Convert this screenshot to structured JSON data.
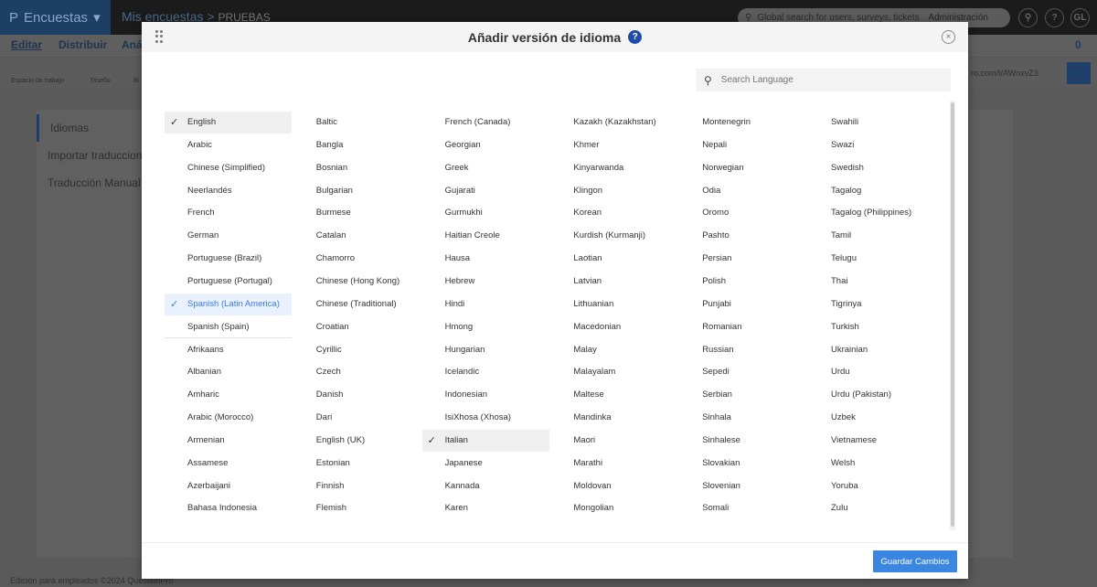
{
  "app": {
    "brand": "Encuestas",
    "breadcrumb_parent": "Mis encuestas",
    "breadcrumb_current": "PRUEBAS",
    "global_search_placeholder": "Global search for users, surveys, tickets",
    "admin_label": "Administración",
    "user_initials": "GL",
    "help": "?",
    "collab_count": "0"
  },
  "nav": {
    "tabs": [
      "Editar",
      "Distribuir",
      "Anál"
    ],
    "tools": [
      "Espacio de trabajo",
      "Diseño",
      "Bi"
    ],
    "url_fragment": "ro.com/t/AWnxvZ3"
  },
  "sidebar": {
    "items": [
      "Idiomas",
      "Importar traducciones",
      "Traducción Manual"
    ]
  },
  "footer": {
    "text": "Edición para empleados ©2024 QuestionPro"
  },
  "modal": {
    "title": "Añadir versión de idioma",
    "help": "?",
    "close": "×",
    "search_placeholder": "Search Language",
    "save_label": "Guardar Cambios",
    "columns": [
      [
        "English",
        "Arabic",
        "Chinese (Simplified)",
        "Neerlandés",
        "French",
        "German",
        "Portuguese (Brazil)",
        "Portuguese (Portugal)",
        "Spanish (Latin America)",
        "Spanish (Spain)",
        "Afrikaans",
        "Albanian",
        "Amharic",
        "Arabic (Morocco)",
        "Armenian",
        "Assamese",
        "Azerbaijani",
        "Bahasa Indonesia"
      ],
      [
        "Baltic",
        "Bangla",
        "Bosnian",
        "Bulgarian",
        "Burmese",
        "Catalan",
        "Chamorro",
        "Chinese (Hong Kong)",
        "Chinese (Traditional)",
        "Croatian",
        "Cyrillic",
        "Czech",
        "Danish",
        "Dari",
        "English (UK)",
        "Estonian",
        "Finnish",
        "Flemish"
      ],
      [
        "French (Canada)",
        "Georgian",
        "Greek",
        "Gujarati",
        "Gurmukhi",
        "Haitian Creole",
        "Hausa",
        "Hebrew",
        "Hindi",
        "Hmong",
        "Hungarian",
        "Icelandic",
        "Indonesian",
        "IsiXhosa (Xhosa)",
        "Italian",
        "Japanese",
        "Kannada",
        "Karen"
      ],
      [
        "Kazakh (Kazakhstan)",
        "Khmer",
        "Kinyarwanda",
        "Klingon",
        "Korean",
        "Kurdish (Kurmanji)",
        "Laotian",
        "Latvian",
        "Lithuanian",
        "Macedonian",
        "Malay",
        "Malayalam",
        "Maltese",
        "Mandinka",
        "Maori",
        "Marathi",
        "Moldovan",
        "Mongolian"
      ],
      [
        "Montenegrin",
        "Nepali",
        "Norwegian",
        "Odia",
        "Oromo",
        "Pashto",
        "Persian",
        "Polish",
        "Punjabi",
        "Romanian",
        "Russian",
        "Sepedi",
        "Serbian",
        "Sinhala",
        "Sinhalese",
        "Slovakian",
        "Slovenian",
        "Somali"
      ],
      [
        "Swahili",
        "Swazi",
        "Swedish",
        "Tagalog",
        "Tagalog (Philippines)",
        "Tamil",
        "Telugu",
        "Thai",
        "Tigrinya",
        "Turkish",
        "Ukrainian",
        "Urdu",
        "Urdu (Pakistan)",
        "Uzbek",
        "Vietnamese",
        "Welsh",
        "Yoruba",
        "Zulu"
      ]
    ],
    "selected": [
      "English",
      "Spanish (Latin America)",
      "Italian"
    ],
    "default_section_end": "Spanish (Spain)"
  },
  "colors": {
    "accent": "#3b86e0",
    "selected_text": "#3c7be0"
  }
}
